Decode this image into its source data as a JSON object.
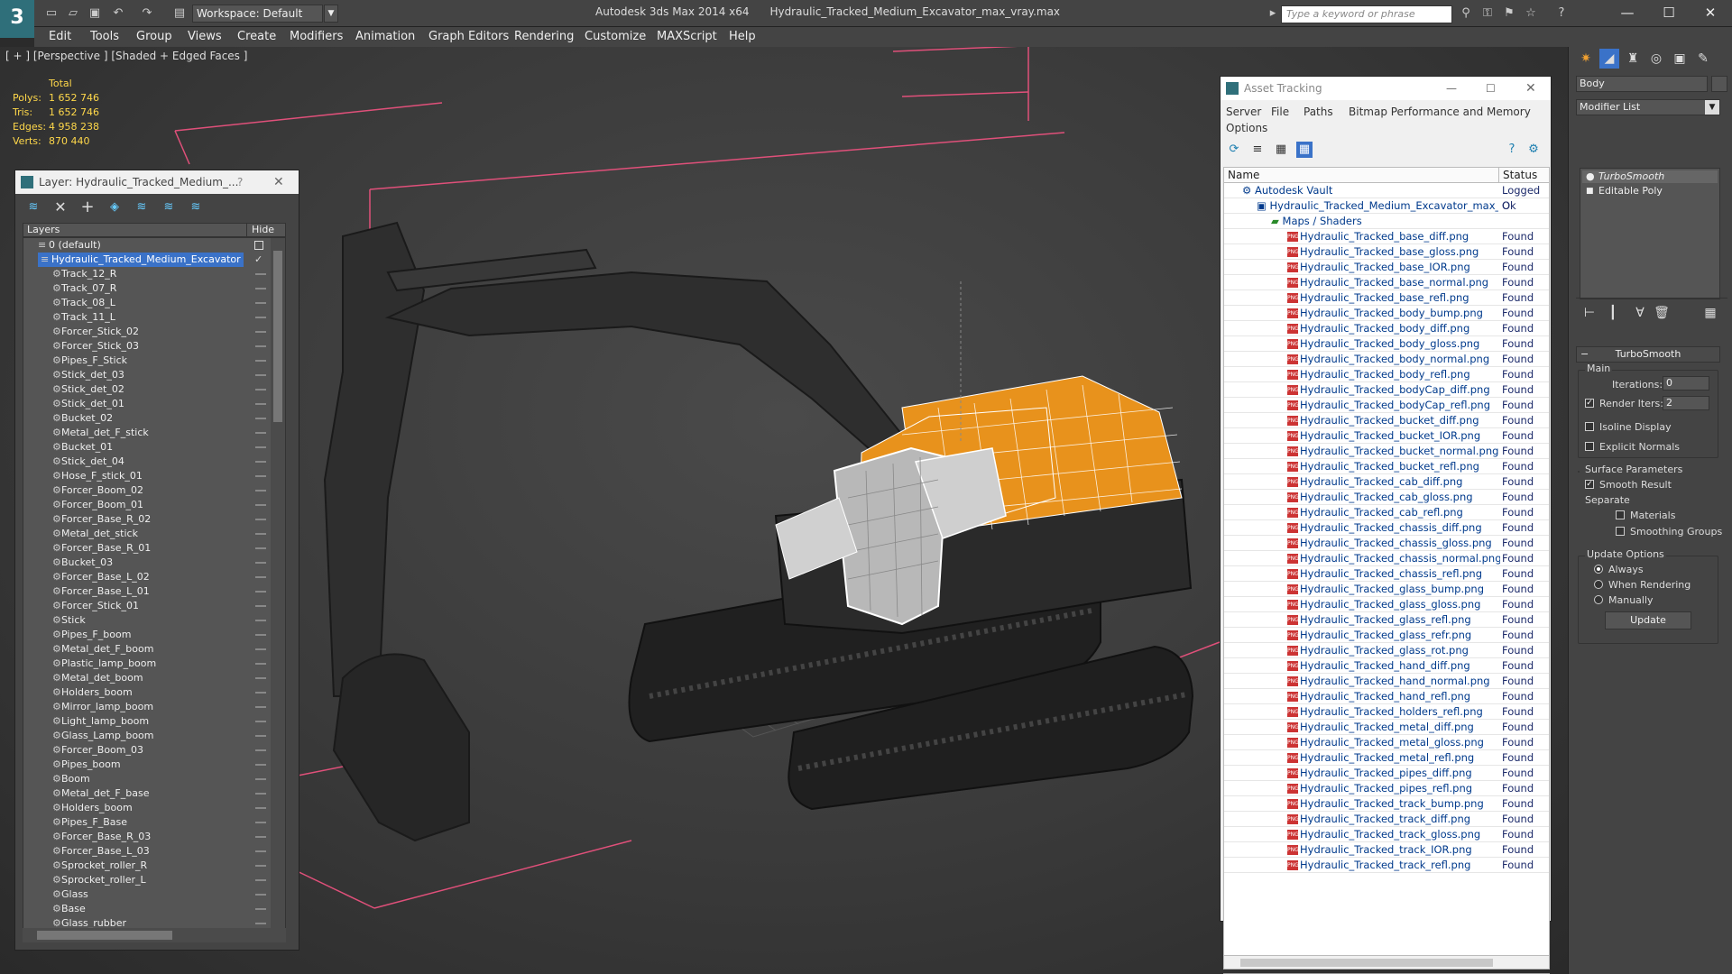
{
  "titlebar": {
    "workspace": "Workspace: Default",
    "app": "Autodesk 3ds Max  2014 x64",
    "file": "Hydraulic_Tracked_Medium_Excavator_max_vray.max",
    "search_placeholder": "Type a keyword or phrase",
    "logo": "3"
  },
  "menu": [
    "Edit",
    "Tools",
    "Group",
    "Views",
    "Create",
    "Modifiers",
    "Animation",
    "Graph Editors",
    "Rendering",
    "Customize",
    "MAXScript",
    "Help"
  ],
  "viewport": {
    "label": "[ + ] [Perspective ] [Shaded + Edged Faces ]",
    "stats": {
      "header": "Total",
      "rows": [
        {
          "k": "Polys:",
          "v": "1 652 746"
        },
        {
          "k": "Tris:",
          "v": "1 652 746"
        },
        {
          "k": "Edges:",
          "v": "4 958 238"
        },
        {
          "k": "Verts:",
          "v": "870 440"
        }
      ]
    }
  },
  "layer_panel": {
    "title": "Layer: Hydraulic_Tracked_Medium_...",
    "help": "?",
    "col_layers": "Layers",
    "col_hide": "Hide",
    "rows": [
      "0 (default)",
      "Hydraulic_Tracked_Medium_Excavator",
      "Track_12_R",
      "Track_07_R",
      "Track_08_L",
      "Track_11_L",
      "Forcer_Stick_02",
      "Forcer_Stick_03",
      "Pipes_F_Stick",
      "Stick_det_03",
      "Stick_det_02",
      "Stick_det_01",
      "Bucket_02",
      "Metal_det_F_stick",
      "Bucket_01",
      "Stick_det_04",
      "Hose_F_stick_01",
      "Forcer_Boom_02",
      "Forcer_Boom_01",
      "Forcer_Base_R_02",
      "Metal_det_stick",
      "Forcer_Base_R_01",
      "Bucket_03",
      "Forcer_Base_L_02",
      "Forcer_Base_L_01",
      "Forcer_Stick_01",
      "Stick",
      "Pipes_F_boom",
      "Metal_det_F_boom",
      "Plastic_lamp_boom",
      "Metal_det_boom",
      "Holders_boom",
      "Mirror_lamp_boom",
      "Light_lamp_boom",
      "Glass_Lamp_boom",
      "Forcer_Boom_03",
      "Pipes_boom",
      "Boom",
      "Metal_det_F_base",
      "Holders_boom",
      "Pipes_F_Base",
      "Forcer_Base_R_03",
      "Forcer_Base_L_03",
      "Sprocket_roller_R",
      "Sprocket_roller_L",
      "Glass",
      "Base",
      "Glass_rubber"
    ]
  },
  "asset_panel": {
    "title": "Asset Tracking",
    "menu": [
      "Server",
      "File",
      "Paths",
      "Bitmap Performance and Memory",
      "Options"
    ],
    "col_name": "Name",
    "col_status": "Status",
    "vault": {
      "name": "Autodesk Vault",
      "status": "Logged O"
    },
    "file": {
      "name": "Hydraulic_Tracked_Medium_Excavator_max_vr...",
      "status": "Ok"
    },
    "maps_label": "Maps / Shaders",
    "png_label": "PNG",
    "maps_status": "Found",
    "maps": [
      "Hydraulic_Tracked_base_diff.png",
      "Hydraulic_Tracked_base_gloss.png",
      "Hydraulic_Tracked_base_IOR.png",
      "Hydraulic_Tracked_base_normal.png",
      "Hydraulic_Tracked_base_refl.png",
      "Hydraulic_Tracked_body_bump.png",
      "Hydraulic_Tracked_body_diff.png",
      "Hydraulic_Tracked_body_gloss.png",
      "Hydraulic_Tracked_body_normal.png",
      "Hydraulic_Tracked_body_refl.png",
      "Hydraulic_Tracked_bodyCap_diff.png",
      "Hydraulic_Tracked_bodyCap_refl.png",
      "Hydraulic_Tracked_bucket_diff.png",
      "Hydraulic_Tracked_bucket_IOR.png",
      "Hydraulic_Tracked_bucket_normal.png",
      "Hydraulic_Tracked_bucket_refl.png",
      "Hydraulic_Tracked_cab_diff.png",
      "Hydraulic_Tracked_cab_gloss.png",
      "Hydraulic_Tracked_cab_refl.png",
      "Hydraulic_Tracked_chassis_diff.png",
      "Hydraulic_Tracked_chassis_gloss.png",
      "Hydraulic_Tracked_chassis_normal.png",
      "Hydraulic_Tracked_chassis_refl.png",
      "Hydraulic_Tracked_glass_bump.png",
      "Hydraulic_Tracked_glass_gloss.png",
      "Hydraulic_Tracked_glass_refl.png",
      "Hydraulic_Tracked_glass_refr.png",
      "Hydraulic_Tracked_glass_rot.png",
      "Hydraulic_Tracked_hand_diff.png",
      "Hydraulic_Tracked_hand_normal.png",
      "Hydraulic_Tracked_hand_refl.png",
      "Hydraulic_Tracked_holders_refl.png",
      "Hydraulic_Tracked_metal_diff.png",
      "Hydraulic_Tracked_metal_gloss.png",
      "Hydraulic_Tracked_metal_refl.png",
      "Hydraulic_Tracked_pipes_diff.png",
      "Hydraulic_Tracked_pipes_refl.png",
      "Hydraulic_Tracked_track_bump.png",
      "Hydraulic_Tracked_track_diff.png",
      "Hydraulic_Tracked_track_gloss.png",
      "Hydraulic_Tracked_track_IOR.png",
      "Hydraulic_Tracked_track_refl.png"
    ]
  },
  "command_panel": {
    "object_name": "Body",
    "modifier_list": "Modifier List",
    "stack": [
      "TurboSmooth",
      "Editable Poly"
    ],
    "rollout": "TurboSmooth",
    "main": "Main",
    "iterations_label": "Iterations:",
    "iterations": "0",
    "render_iters_label": "Render Iters:",
    "render_iters": "2",
    "isoline": "Isoline Display",
    "explicit": "Explicit Normals",
    "surface": "Surface Parameters",
    "smooth_result": "Smooth Result",
    "separate": "Separate",
    "materials": "Materials",
    "smoothing_groups": "Smoothing Groups",
    "update_options": "Update Options",
    "always": "Always",
    "when_rendering": "When Rendering",
    "manually": "Manually",
    "update": "Update",
    "checkmark": "✓"
  },
  "colors": {
    "accent": "#3a72c8",
    "orange": "#e8921c",
    "magenta": "#e0507a"
  }
}
